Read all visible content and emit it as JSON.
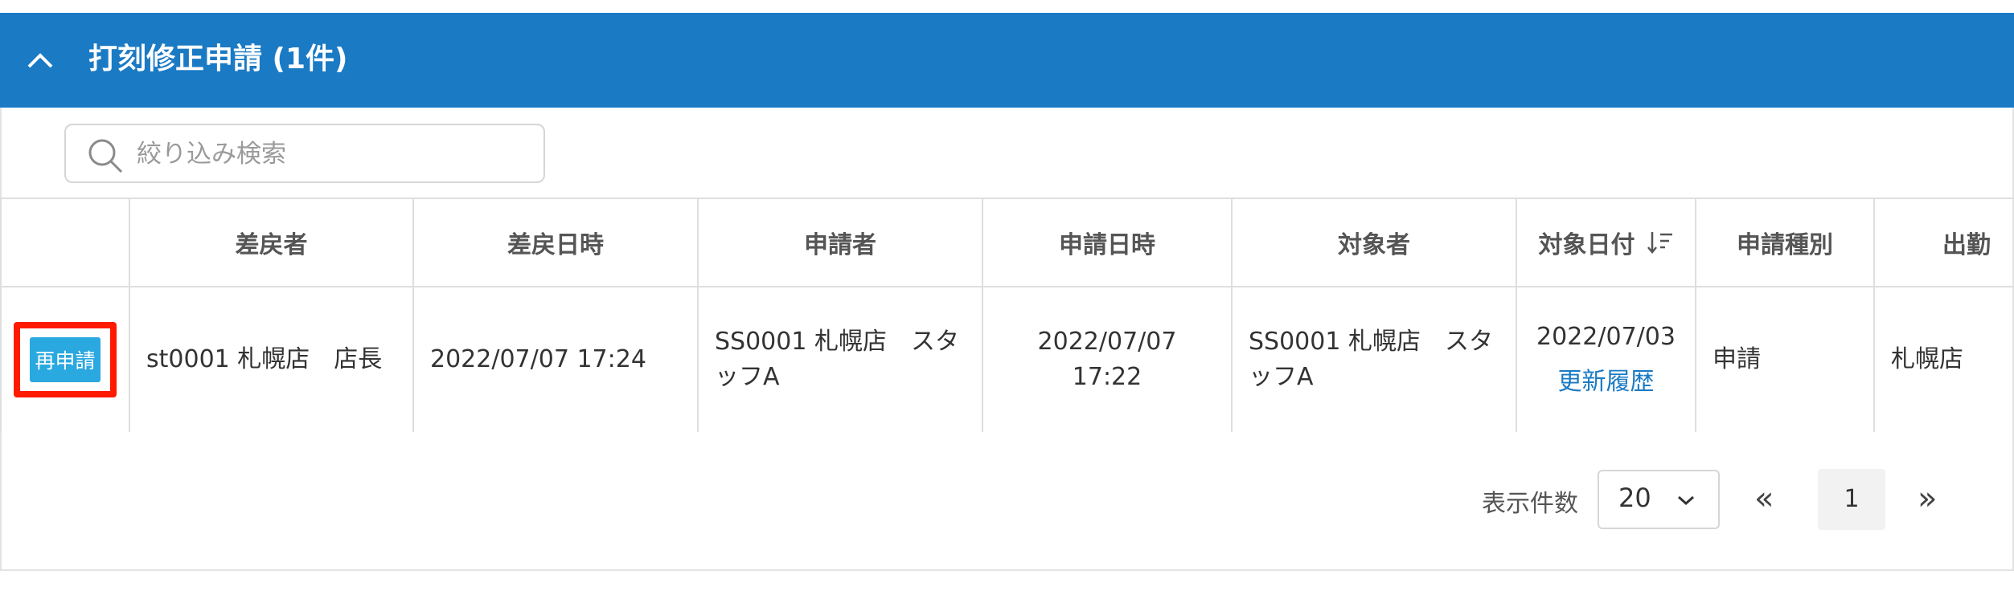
{
  "section": {
    "title": "打刻修正申請 (1件)"
  },
  "search": {
    "placeholder": "絞り込み検索"
  },
  "table": {
    "headers": [
      "",
      "差戻者",
      "差戻日時",
      "申請者",
      "申請日時",
      "対象者",
      "対象日付",
      "申請種別",
      "出勤"
    ],
    "rows": [
      {
        "action_label": "再申請",
        "returned_by": "st0001 札幌店　店長",
        "returned_at": "2022/07/07 17:24",
        "applicant": "SS0001 札幌店　スタッフA",
        "applied_at": "2022/07/07 17:22",
        "target_person": "SS0001 札幌店　スタッフA",
        "target_date": "2022/07/03",
        "history_link": "更新履歴",
        "request_type": "申請",
        "work_location": "札幌店"
      }
    ]
  },
  "pagination": {
    "page_size_label": "表示件数",
    "page_size_value": "20",
    "prev": "«",
    "current_page": "1",
    "next": "»"
  },
  "colors": {
    "header_bg": "#1a7ac4",
    "button_bg": "#2aa8e0",
    "highlight": "#ff1a00",
    "link": "#1a7ac4"
  }
}
